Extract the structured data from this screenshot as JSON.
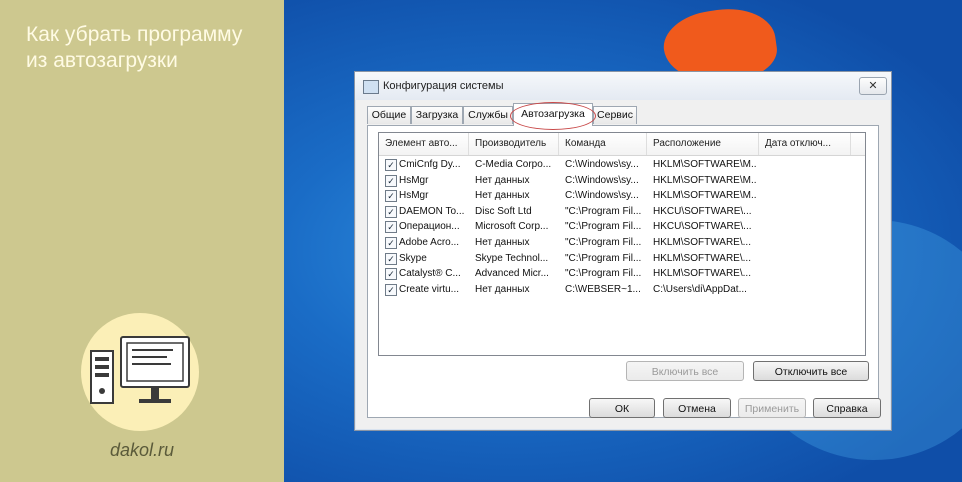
{
  "article": {
    "title": "Как убрать программу из автозагрузки",
    "site": "dakol.ru"
  },
  "window": {
    "title": "Конфигурация системы",
    "close_label": "✕"
  },
  "tabs": [
    {
      "label": "Общие"
    },
    {
      "label": "Загрузка"
    },
    {
      "label": "Службы"
    },
    {
      "label": "Автозагрузка"
    },
    {
      "label": "Сервис"
    }
  ],
  "active_tab": "Автозагрузка",
  "columns": [
    "Элемент авто...",
    "Производитель",
    "Команда",
    "Расположение",
    "Дата отключ..."
  ],
  "rows": [
    {
      "checked": true,
      "name": "CmiCnfg Dy...",
      "vendor": "C-Media Corpo...",
      "command": "C:\\Windows\\sy...",
      "location": "HKLM\\SOFTWARE\\M...",
      "date": ""
    },
    {
      "checked": true,
      "name": "HsMgr",
      "vendor": "Нет данных",
      "command": "C:\\Windows\\sy...",
      "location": "HKLM\\SOFTWARE\\M...",
      "date": ""
    },
    {
      "checked": true,
      "name": "HsMgr",
      "vendor": "Нет данных",
      "command": "C:\\Windows\\sy...",
      "location": "HKLM\\SOFTWARE\\M...",
      "date": ""
    },
    {
      "checked": true,
      "name": "DAEMON To...",
      "vendor": "Disc Soft Ltd",
      "command": "\"C:\\Program Fil...",
      "location": "HKCU\\SOFTWARE\\...",
      "date": ""
    },
    {
      "checked": true,
      "name": "Операцион...",
      "vendor": "Microsoft Corp...",
      "command": "\"C:\\Program Fil...",
      "location": "HKCU\\SOFTWARE\\...",
      "date": ""
    },
    {
      "checked": true,
      "name": "Adobe Acro...",
      "vendor": "Нет данных",
      "command": "\"C:\\Program Fil...",
      "location": "HKLM\\SOFTWARE\\...",
      "date": ""
    },
    {
      "checked": true,
      "name": "Skype",
      "vendor": "Skype Technol...",
      "command": "\"C:\\Program Fil...",
      "location": "HKLM\\SOFTWARE\\...",
      "date": ""
    },
    {
      "checked": true,
      "name": "Catalyst® C...",
      "vendor": "Advanced Micr...",
      "command": "\"C:\\Program Fil...",
      "location": "HKLM\\SOFTWARE\\...",
      "date": ""
    },
    {
      "checked": true,
      "name": "Create virtu...",
      "vendor": "Нет данных",
      "command": "C:\\WEBSER~1...",
      "location": "C:\\Users\\di\\AppDat...",
      "date": ""
    }
  ],
  "buttons": {
    "enable_all": "Включить все",
    "disable_all": "Отключить все",
    "ok": "ОК",
    "cancel": "Отмена",
    "apply": "Применить",
    "help": "Справка"
  },
  "colors": {
    "left_panel": "#cdc88f",
    "logo_circle": "#fbefb7",
    "desktop_blue": "#1a6cc6",
    "tab_highlight": "#c84848"
  },
  "icons": {
    "logo": "desktop-computer-icon",
    "window": "msconfig-icon",
    "close": "close-icon",
    "checkbox": "checkmark-icon"
  }
}
